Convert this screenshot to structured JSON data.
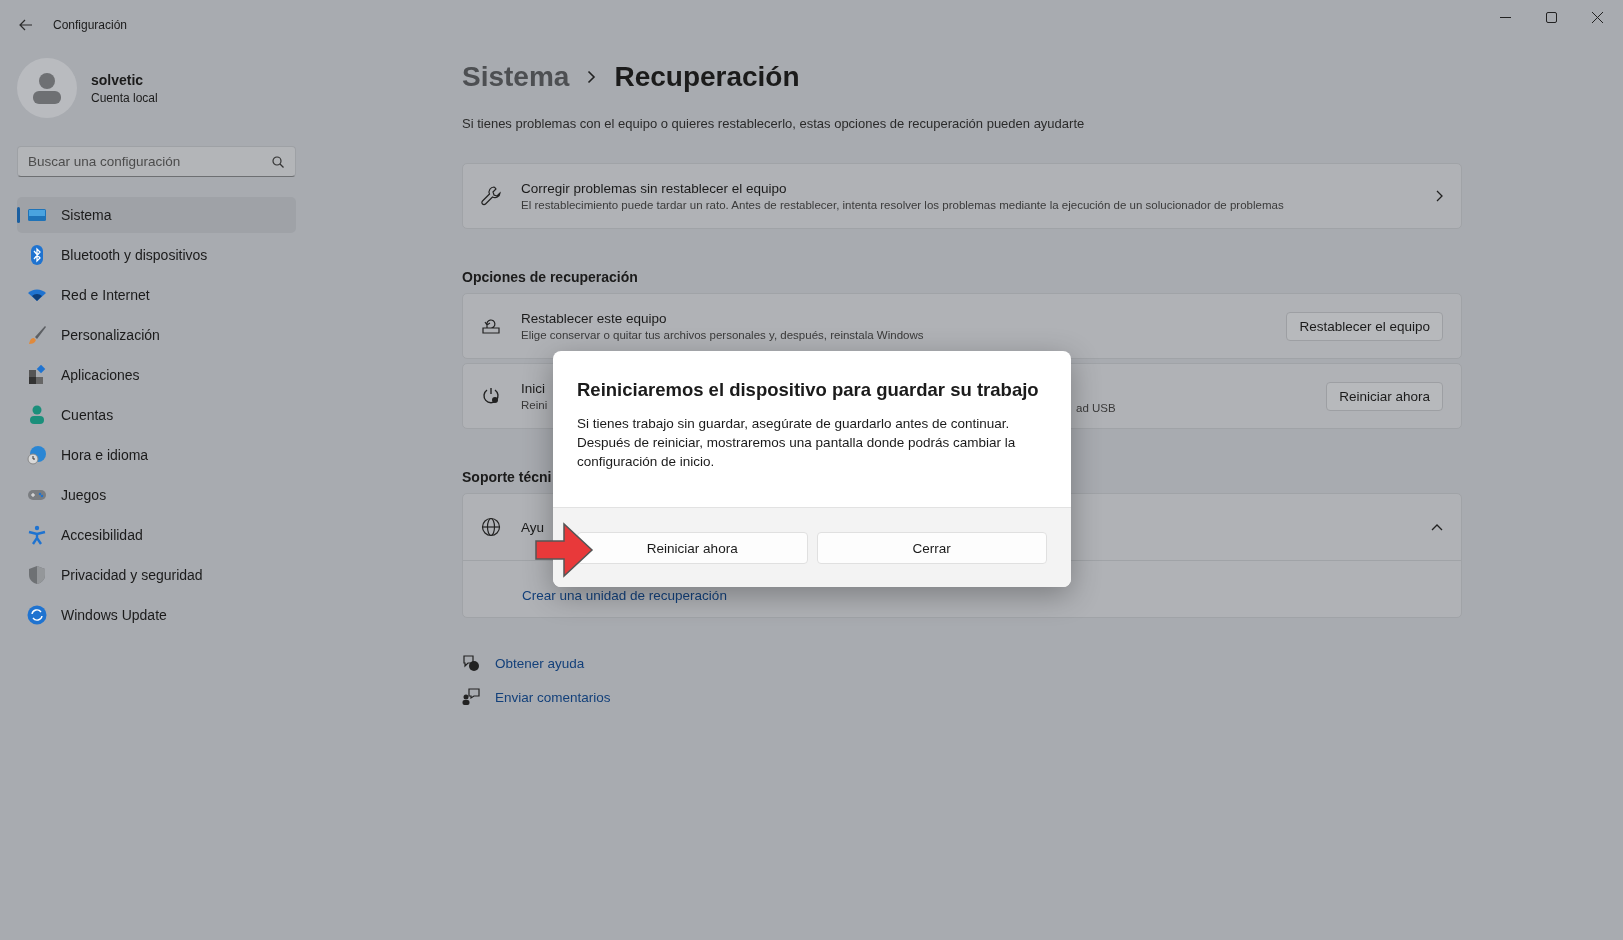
{
  "window": {
    "title": "Configuración"
  },
  "user": {
    "name": "solvetic",
    "account": "Cuenta local"
  },
  "search": {
    "placeholder": "Buscar una configuración"
  },
  "nav": [
    {
      "label": "Sistema",
      "selected": true
    },
    {
      "label": "Bluetooth y dispositivos",
      "selected": false
    },
    {
      "label": "Red e Internet",
      "selected": false
    },
    {
      "label": "Personalización",
      "selected": false
    },
    {
      "label": "Aplicaciones",
      "selected": false
    },
    {
      "label": "Cuentas",
      "selected": false
    },
    {
      "label": "Hora e idioma",
      "selected": false
    },
    {
      "label": "Juegos",
      "selected": false
    },
    {
      "label": "Accesibilidad",
      "selected": false
    },
    {
      "label": "Privacidad y seguridad",
      "selected": false
    },
    {
      "label": "Windows Update",
      "selected": false
    }
  ],
  "breadcrumb": {
    "parent": "Sistema",
    "current": "Recuperación"
  },
  "intro": "Si tienes problemas con el equipo o quieres restablecerlo, estas opciones de recuperación pueden ayudarte",
  "fix_card": {
    "title": "Corregir problemas sin restablecer el equipo",
    "description": "El restablecimiento puede tardar un rato. Antes de restablecer, intenta resolver los problemas mediante la ejecución de un solucionador de problemas"
  },
  "recovery": {
    "heading": "Opciones de recuperación",
    "options": [
      {
        "title": "Restablecer este equipo",
        "description": "Elige conservar o quitar tus archivos personales y, después, reinstala Windows",
        "button": "Restablecer el equipo"
      },
      {
        "title": "Inici",
        "description": "Reini",
        "description_tail": "ad USB",
        "button": "Reiniciar ahora"
      }
    ]
  },
  "support": {
    "heading": "Soporte técni",
    "title": "Ayu",
    "expanded": true,
    "link": "Crear una unidad de recuperación"
  },
  "footer_links": [
    {
      "label": "Obtener ayuda"
    },
    {
      "label": "Enviar comentarios"
    }
  ],
  "dialog": {
    "title": "Reiniciaremos el dispositivo para guardar su trabajo",
    "body": "Si tienes trabajo sin guardar, asegúrate de guardarlo antes de continuar. Después de reiniciar, mostraremos una pantalla donde podrás cambiar la configuración de inicio.",
    "buttons": [
      "Reiniciar ahora",
      "Cerrar"
    ]
  }
}
